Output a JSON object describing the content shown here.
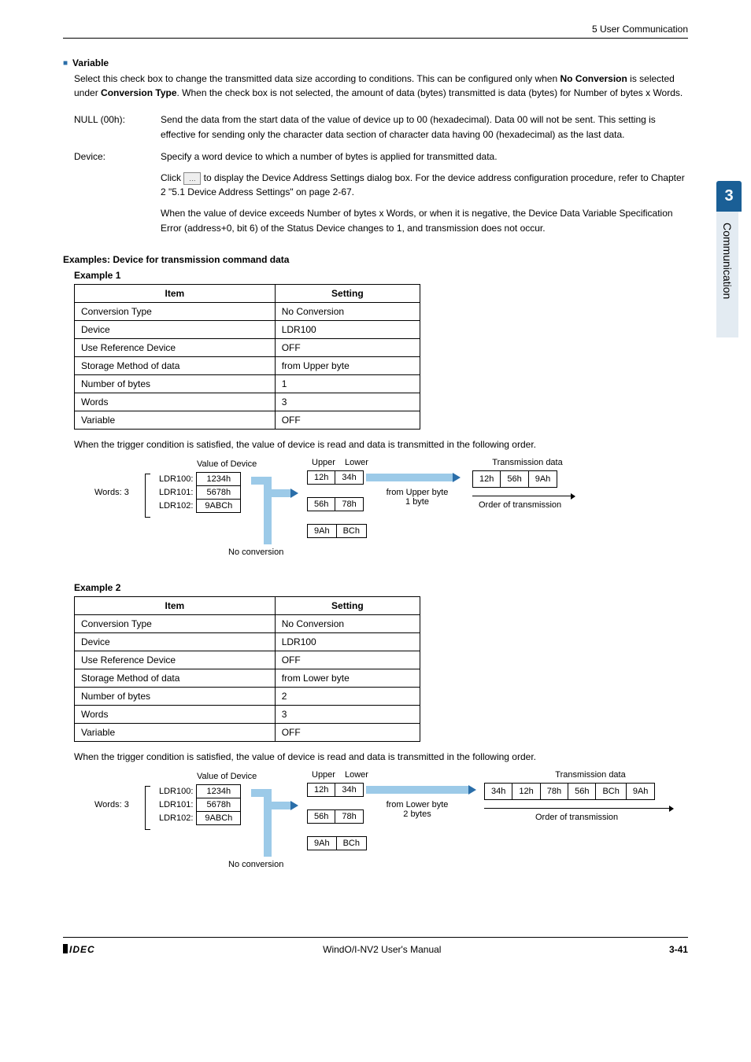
{
  "header": {
    "breadcrumb": "5 User Communication"
  },
  "sideTab": {
    "chapter": "3",
    "name": "Communication"
  },
  "variable": {
    "title": "Variable",
    "intro_a": "Select this check box to change the transmitted data size according to conditions. This can be configured only when ",
    "intro_b": "No Conversion",
    "intro_c": " is selected under ",
    "intro_d": "Conversion Type",
    "intro_e": ". When the check box is not selected, the amount of data (bytes) transmitted is data (bytes) for Number of bytes x Words."
  },
  "null_row": {
    "term": "NULL (00h):",
    "body": "Send the data from the start data of the value of device up to 00 (hexadecimal). Data 00 will not be sent. This setting is effective for sending only the character data section of character data having 00 (hexadecimal) as the last data."
  },
  "device_row": {
    "term": "Device:",
    "body1": "Specify a word device to which a number of bytes is applied for transmitted data.",
    "body2a": "Click ",
    "body2b": " to display the Device Address Settings dialog box. For the device address configuration procedure, refer to Chapter 2 \"5.1 Device Address Settings\" on page 2-67.",
    "body3": "When the value of device exceeds Number of bytes x Words, or when it is negative, the Device Data Variable Specification Error (address+0, bit 6) of the Status Device changes to 1, and transmission does not occur.",
    "btn": "…"
  },
  "examples_h": "Examples: Device for transmission command data",
  "th": {
    "item": "Item",
    "setting": "Setting"
  },
  "rowlabels": {
    "conv": "Conversion Type",
    "dev": "Device",
    "ref": "Use Reference Device",
    "stor": "Storage Method of data",
    "nbytes": "Number of bytes",
    "words": "Words",
    "var": "Variable"
  },
  "ex1": {
    "label": "Example 1",
    "conv": "No Conversion",
    "dev": "LDR100",
    "ref": "OFF",
    "stor": "from Upper byte",
    "nbytes": "1",
    "words": "3",
    "var": "OFF",
    "note": "When the trigger condition is satisfied, the value of device is read and data is transmitted in the following order."
  },
  "ex2": {
    "label": "Example 2",
    "conv": "No Conversion",
    "dev": "LDR100",
    "ref": "OFF",
    "stor": "from Lower byte",
    "nbytes": "2",
    "words": "3",
    "var": "OFF",
    "note": "When the trigger condition is satisfied, the value of device is read and data is transmitted in the following order."
  },
  "diag": {
    "value_of_device": "Value of Device",
    "words3": "Words: 3",
    "ldr": [
      "LDR100:",
      "LDR101:",
      "LDR102:"
    ],
    "vals": [
      "1234h",
      "5678h",
      "9ABCh"
    ],
    "upper": "Upper",
    "lower": "Lower",
    "bytes": [
      [
        "12h",
        "34h"
      ],
      [
        "56h",
        "78h"
      ],
      [
        "9Ah",
        "BCh"
      ]
    ],
    "mid1": "from Upper byte\n1 byte",
    "mid2": "from Lower byte\n2 bytes",
    "trans_title": "Transmission data",
    "trans1": [
      "12h",
      "56h",
      "9Ah"
    ],
    "trans2": [
      "34h",
      "12h",
      "78h",
      "56h",
      "BCh",
      "9Ah"
    ],
    "order": "Order of transmission",
    "noconv": "No conversion"
  },
  "footer": {
    "brand": "IDEC",
    "mid": "WindO/I-NV2 User's Manual",
    "pg": "3-41"
  }
}
